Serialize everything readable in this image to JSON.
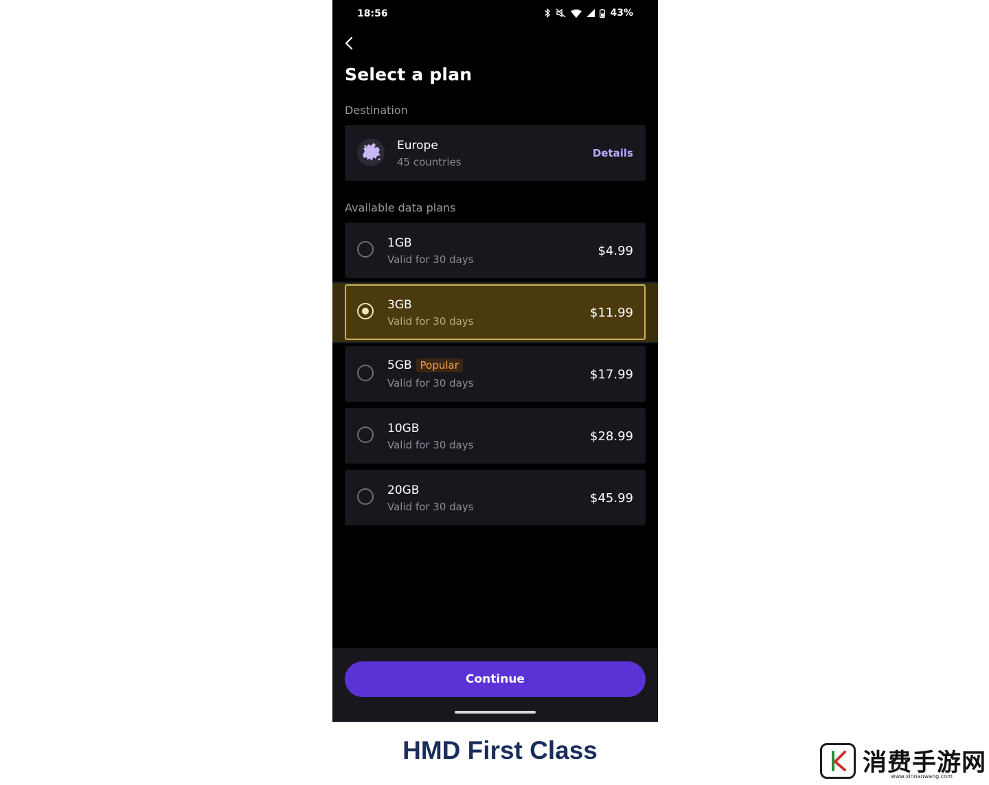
{
  "status_bar": {
    "time": "18:56",
    "battery": "43%",
    "icons": [
      "bluetooth-icon",
      "mute-icon",
      "wifi-icon",
      "signal-icon",
      "battery-icon"
    ]
  },
  "header": {
    "back_icon": "chevron-left-icon",
    "title": "Select a plan"
  },
  "destination": {
    "section_label": "Destination",
    "name": "Europe",
    "subtitle": "45 countries",
    "details_label": "Details",
    "icon": "europe-map-icon"
  },
  "plans": {
    "section_label": "Available data plans",
    "selected_index": 1,
    "items": [
      {
        "name": "1GB",
        "validity": "Valid for 30 days",
        "price": "$4.99",
        "badge": ""
      },
      {
        "name": "3GB",
        "validity": "Valid for 30 days",
        "price": "$11.99",
        "badge": ""
      },
      {
        "name": "5GB",
        "validity": "Valid for 30 days",
        "price": "$17.99",
        "badge": "Popular"
      },
      {
        "name": "10GB",
        "validity": "Valid for 30 days",
        "price": "$28.99",
        "badge": ""
      },
      {
        "name": "20GB",
        "validity": "Valid for 30 days",
        "price": "$45.99",
        "badge": ""
      }
    ]
  },
  "footer": {
    "continue_label": "Continue"
  },
  "caption": "HMD First Class",
  "watermark": {
    "text": "消费手游网",
    "url": "www.xinnanwang.com"
  },
  "colors": {
    "background": "#000000",
    "card": "#17171d",
    "accent": "#5b32d6",
    "link": "#b7a8ff",
    "selected_card": "#4a3a0d",
    "badge_text": "#f5a04a",
    "caption": "#1a2d5c"
  }
}
